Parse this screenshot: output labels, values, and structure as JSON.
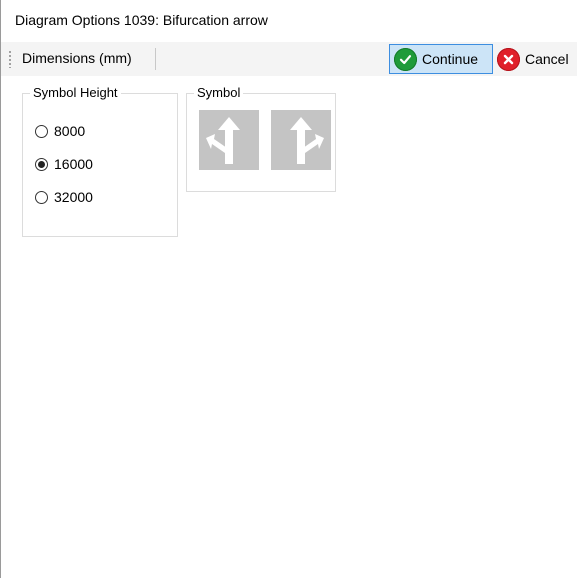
{
  "window": {
    "title": "Diagram Options 1039: Bifurcation arrow"
  },
  "toolbar": {
    "dimensions_label": "Dimensions (mm)",
    "continue_label": "Continue",
    "cancel_label": "Cancel"
  },
  "symbol_height": {
    "legend": "Symbol Height",
    "options": [
      {
        "label": "8000",
        "selected": false
      },
      {
        "label": "16000",
        "selected": true
      },
      {
        "label": "32000",
        "selected": false
      }
    ]
  },
  "symbol": {
    "legend": "Symbol",
    "tiles": [
      {
        "icon": "bifurcation-arrow-left-icon"
      },
      {
        "icon": "bifurcation-arrow-right-icon"
      }
    ]
  },
  "colors": {
    "continue_bg": "#cce4f7",
    "continue_border": "#3d8ee0",
    "ok_green": "#1f9b3a",
    "cancel_red": "#e0202a",
    "tile_gray": "#c4c4c4"
  }
}
